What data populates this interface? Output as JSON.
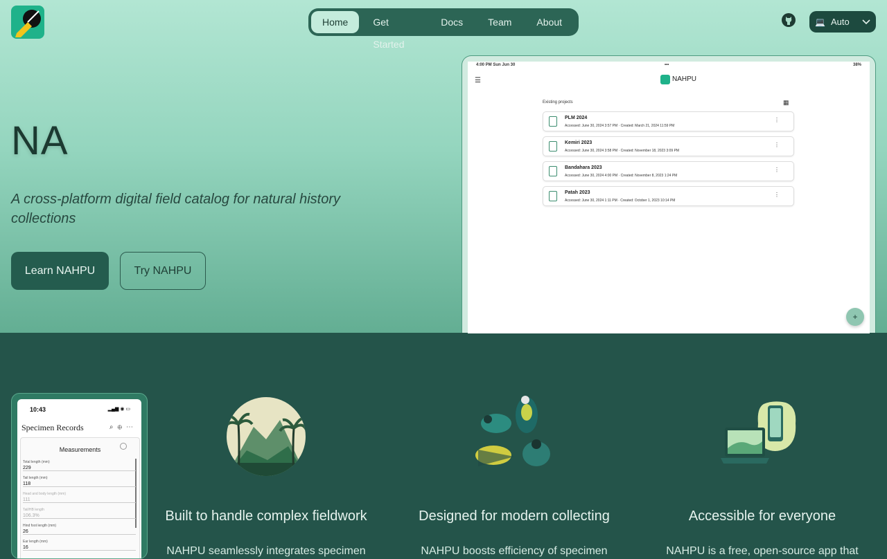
{
  "header": {
    "logo_icon": "pen-logo-icon",
    "nav": [
      {
        "label": "Home",
        "active": true
      },
      {
        "label": "Get Started",
        "active": false
      },
      {
        "label": "Docs",
        "active": false
      },
      {
        "label": "Team",
        "active": false
      },
      {
        "label": "About",
        "active": false
      }
    ],
    "github_icon": "github-icon",
    "theme_select": {
      "value": "Auto",
      "icon": "laptop-icon"
    }
  },
  "hero": {
    "title": "NA",
    "subtitle": "A cross-platform digital field catalog for natural history collections",
    "learn_button": "Learn NAHPU",
    "try_button": "Try NAHPU"
  },
  "tablet": {
    "status_left": "4:00 PM  Sun Jun 30",
    "status_dots": "•••",
    "status_right": "38%",
    "app_name": "NAHPU",
    "section_title": "Existing projects",
    "projects": [
      {
        "name": "PLM 2024",
        "meta": "Accessed: June 30, 2024 3:57 PM · Created: March 21, 2024 11:59 PM"
      },
      {
        "name": "Kemiri 2023",
        "meta": "Accessed: June 30, 2024 3:58 PM · Created: November 18, 2023 3:09 PM"
      },
      {
        "name": "Bandahara 2023",
        "meta": "Accessed: June 30, 2024 4:00 PM · Created: November 8, 2023 1:24 PM"
      },
      {
        "name": "Patah 2023",
        "meta": "Accessed: June 30, 2024 1:11 PM · Created: October 1, 2023 10:14 PM"
      }
    ],
    "fab_label": "+"
  },
  "phone": {
    "time": "10:43",
    "title": "Specimen Records",
    "card_title": "Measurements",
    "fields": [
      {
        "label": "Total length (mm)",
        "value": "229",
        "dim": false
      },
      {
        "label": "Tail length (mm)",
        "value": "118",
        "dim": false
      },
      {
        "label": "Head and body length (mm)",
        "value": "111",
        "dim": true
      },
      {
        "label": "Tail/HB length",
        "value": "106.3%",
        "dim": true
      },
      {
        "label": "Hind foot length (mm)",
        "value": "26",
        "dim": false
      },
      {
        "label": "Ear length (mm)",
        "value": "16",
        "dim": false
      }
    ]
  },
  "features": [
    {
      "icon": "mountain-palm-icon",
      "title": "Built to handle complex fieldwork",
      "body": "NAHPU seamlessly integrates specimen"
    },
    {
      "icon": "animals-illustration-icon",
      "title": "Designed for modern collecting",
      "body": "NAHPU boosts efficiency of specimen"
    },
    {
      "icon": "devices-icon",
      "title": "Accessible for everyone",
      "body": "NAHPU is a free, open-source app that"
    }
  ]
}
